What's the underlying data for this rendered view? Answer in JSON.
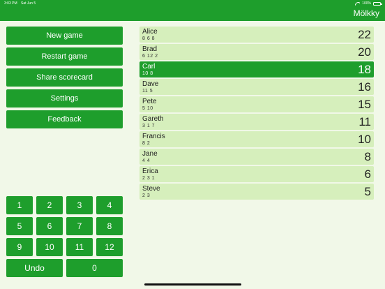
{
  "status_bar": {
    "time": "3:03 PM",
    "date": "Sat Jun 5",
    "battery": "100%"
  },
  "app_title": "Mölkky",
  "menu": {
    "new_game": "New game",
    "restart_game": "Restart game",
    "share_scorecard": "Share scorecard",
    "settings": "Settings",
    "feedback": "Feedback"
  },
  "keypad": {
    "keys": [
      "1",
      "2",
      "3",
      "4",
      "5",
      "6",
      "7",
      "8",
      "9",
      "10",
      "11",
      "12"
    ],
    "undo": "Undo",
    "zero": "0"
  },
  "players": [
    {
      "name": "Alice",
      "throws": "8 6 8",
      "score": "22"
    },
    {
      "name": "Brad",
      "throws": "6 12 2",
      "score": "20"
    },
    {
      "name": "Carl",
      "throws": "10 8",
      "score": "18"
    },
    {
      "name": "Dave",
      "throws": "11 5",
      "score": "16"
    },
    {
      "name": "Pete",
      "throws": "5 10",
      "score": "15"
    },
    {
      "name": "Gareth",
      "throws": "3 1 7",
      "score": "11"
    },
    {
      "name": "Francis",
      "throws": "8 2",
      "score": "10"
    },
    {
      "name": "Jane",
      "throws": "4 4",
      "score": "8"
    },
    {
      "name": "Erica",
      "throws": "2 3 1",
      "score": "6"
    },
    {
      "name": "Steve",
      "throws": "2 3",
      "score": "5"
    }
  ],
  "active_player_index": 2,
  "colors": {
    "accent": "#1e9e2c",
    "row_background": "#d6efbc",
    "page_background": "#f1f8e8"
  }
}
